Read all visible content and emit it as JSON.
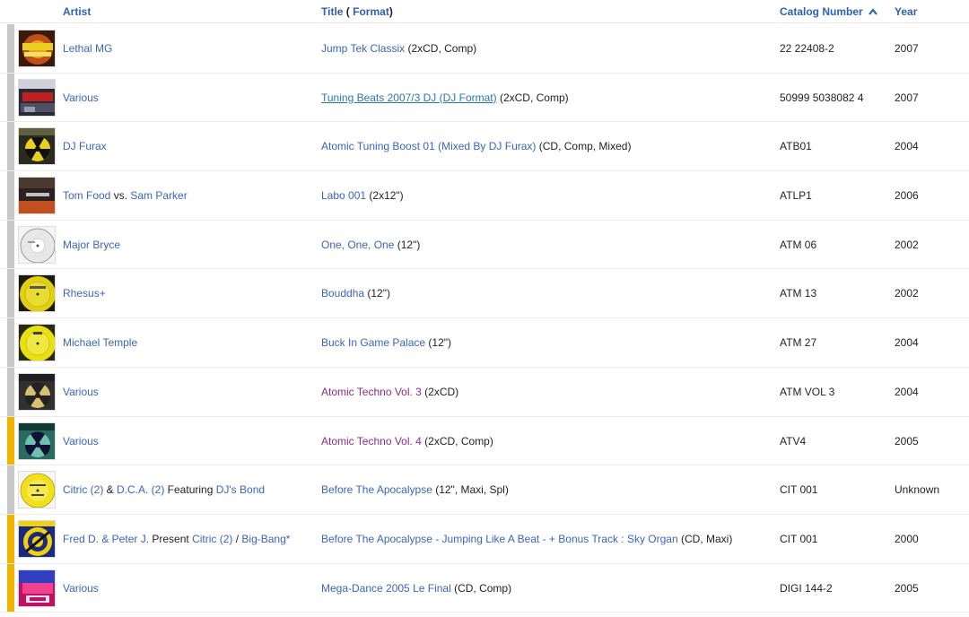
{
  "header": {
    "artist": "Artist",
    "title_a": "Title",
    "title_paren_open": "(",
    "title_b": "Format",
    "title_paren_close": ")",
    "catalog": "Catalog Number",
    "year": "Year"
  },
  "colors": {
    "link": "#3a64c0",
    "visited": "#8b2c8b",
    "bar_gray": "#c8c8c8",
    "bar_yellow": "#f0b400"
  },
  "rows": [
    {
      "artist": [
        {
          "t": "Lethal MG",
          "link": true
        }
      ],
      "title": [
        {
          "t": "Jump Tek Classix",
          "link": true
        },
        {
          "t": " (2xCD, Comp)"
        }
      ],
      "catalog": "22 22408-2",
      "year": "2007",
      "bar": "gray",
      "thumb": "jumptek"
    },
    {
      "artist": [
        {
          "t": "Various",
          "link": true
        }
      ],
      "title": [
        {
          "t": "Tuning Beats 2007/3 DJ (DJ Format)",
          "link": true,
          "hovered": true
        },
        {
          "t": " (2xCD, Comp)"
        }
      ],
      "catalog": "50999 5038082 4",
      "year": "2007",
      "bar": "gray",
      "thumb": "tuning"
    },
    {
      "artist": [
        {
          "t": "DJ Furax",
          "link": true
        }
      ],
      "title": [
        {
          "t": "Atomic Tuning Boost 01 (Mixed By DJ Furax)",
          "link": true
        },
        {
          "t": " (CD, Comp, Mixed)"
        }
      ],
      "catalog": "ATB01",
      "year": "2004",
      "bar": "gray",
      "thumb": "atomic"
    },
    {
      "artist": [
        {
          "t": "Tom Food",
          "link": true
        },
        {
          "t": " vs. "
        },
        {
          "t": "Sam Parker",
          "link": true
        }
      ],
      "title": [
        {
          "t": "Labo 001",
          "link": true
        },
        {
          "t": " (2x12\")"
        }
      ],
      "catalog": "ATLP1",
      "year": "2006",
      "bar": "gray",
      "thumb": "labo"
    },
    {
      "artist": [
        {
          "t": "Major Bryce",
          "link": true
        }
      ],
      "title": [
        {
          "t": "One, One, One",
          "link": true
        },
        {
          "t": " (12\")"
        }
      ],
      "catalog": "ATM 06",
      "year": "2002",
      "bar": "gray",
      "thumb": "vinyl_white"
    },
    {
      "artist": [
        {
          "t": "Rhesus+",
          "link": true
        }
      ],
      "title": [
        {
          "t": "Bouddha",
          "link": true
        },
        {
          "t": " (12\")"
        }
      ],
      "catalog": "ATM 13",
      "year": "2002",
      "bar": "gray",
      "thumb": "vinyl_yellow"
    },
    {
      "artist": [
        {
          "t": "Michael Temple",
          "link": true
        }
      ],
      "title": [
        {
          "t": "Buck In Game Palace",
          "link": true
        },
        {
          "t": " (12\")"
        }
      ],
      "catalog": "ATM 27",
      "year": "2004",
      "bar": "gray",
      "thumb": "vinyl_yellow2"
    },
    {
      "artist": [
        {
          "t": "Various",
          "link": true
        }
      ],
      "title": [
        {
          "t": "Atomic Techno Vol. 3",
          "link": true,
          "visited": true
        },
        {
          "t": " (2xCD)"
        }
      ],
      "catalog": "ATM VOL 3",
      "year": "2004",
      "bar": "gray",
      "thumb": "atomic_techno3"
    },
    {
      "artist": [
        {
          "t": "Various",
          "link": true
        }
      ],
      "title": [
        {
          "t": "Atomic Techno Vol. 4",
          "link": true,
          "visited": true
        },
        {
          "t": " (2xCD, Comp)"
        }
      ],
      "catalog": "ATV4",
      "year": "2005",
      "bar": "yellow",
      "thumb": "atomic_techno4"
    },
    {
      "artist": [
        {
          "t": "Citric (2)",
          "link": true
        },
        {
          "t": " & "
        },
        {
          "t": "D.C.A. (2)",
          "link": true
        },
        {
          "t": " Featuring "
        },
        {
          "t": "DJ's Bond",
          "link": true
        }
      ],
      "title": [
        {
          "t": "Before The Apocalypse",
          "link": true
        },
        {
          "t": " (12\", Maxi, Spl)"
        }
      ],
      "catalog": "CIT 001",
      "year": "Unknown",
      "bar": "gray",
      "thumb": "citric_vinyl"
    },
    {
      "artist": [
        {
          "t": "Fred D. & Peter J.",
          "link": true
        },
        {
          "t": " Present "
        },
        {
          "t": "Citric (2)",
          "link": true
        },
        {
          "t": " / "
        },
        {
          "t": "Big-Bang*",
          "link": true
        }
      ],
      "title": [
        {
          "t": "Before The Apocalypse - Jumping Like A Beat - + Bonus Track : Sky Organ",
          "link": true
        },
        {
          "t": " (CD, Maxi)"
        }
      ],
      "catalog": "CIT 001",
      "year": "2000",
      "bar": "yellow",
      "thumb": "citric_cd"
    },
    {
      "artist": [
        {
          "t": "Various",
          "link": true
        }
      ],
      "title": [
        {
          "t": "Mega-Dance 2005 Le Final",
          "link": true
        },
        {
          "t": " (CD, Comp)"
        }
      ],
      "catalog": "DIGI 144-2",
      "year": "2005",
      "bar": "yellow",
      "thumb": "megadance"
    }
  ]
}
